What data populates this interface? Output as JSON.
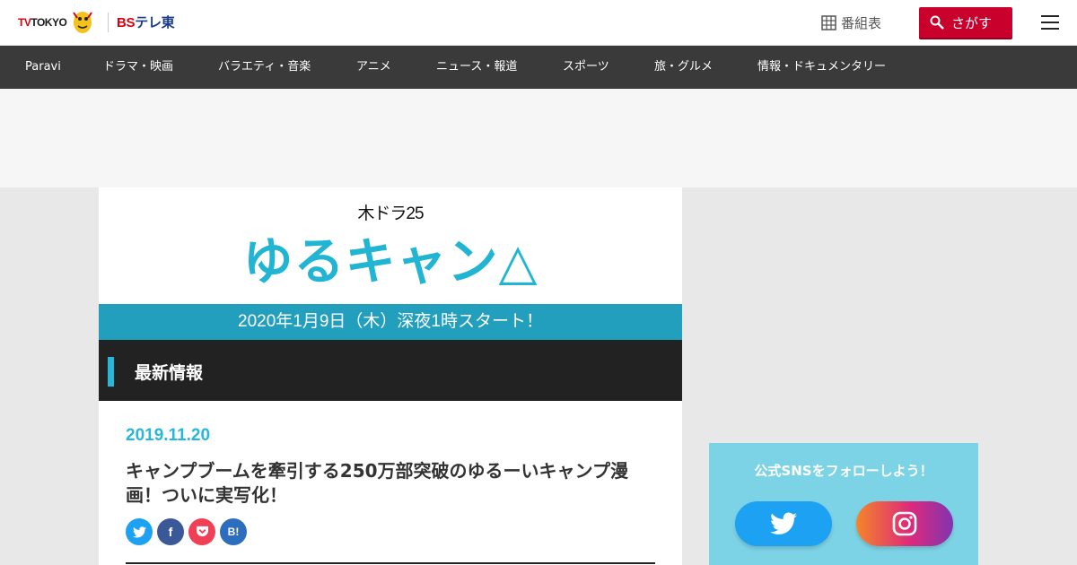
{
  "header": {
    "logo_tv": "TV",
    "logo_tokyo": "TOKYO",
    "logo_bs_prefix": "BS",
    "logo_bs_suffix": "テレ東",
    "bangumi_label": "番組表",
    "search_label": "さがす"
  },
  "nav": {
    "items": [
      "Paravi",
      "ドラマ・映画",
      "バラエティ・音楽",
      "アニメ",
      "ニュース・報道",
      "スポーツ",
      "旅・グルメ",
      "情報・ドキュメンタリー"
    ]
  },
  "main": {
    "slot_label": "木ドラ25",
    "show_title": "ゆるキャン△",
    "start_text": "2020年1月9日（木）深夜1時スタート！",
    "section_label": "最新情報",
    "news": {
      "date": "2019.11.20",
      "title": "キャンプブームを牽引する250万部突破のゆるーいキャンプ漫画！ついに実写化！"
    },
    "share": {
      "facebook": "f",
      "hatena": "B!"
    }
  },
  "sidebar": {
    "sns_title": "公式SNSをフォローしよう！"
  },
  "colors": {
    "accent": "#21b5d3",
    "start_bar": "#229fbd",
    "search": "#c8002b",
    "nav_bg": "#3a3a3a"
  }
}
